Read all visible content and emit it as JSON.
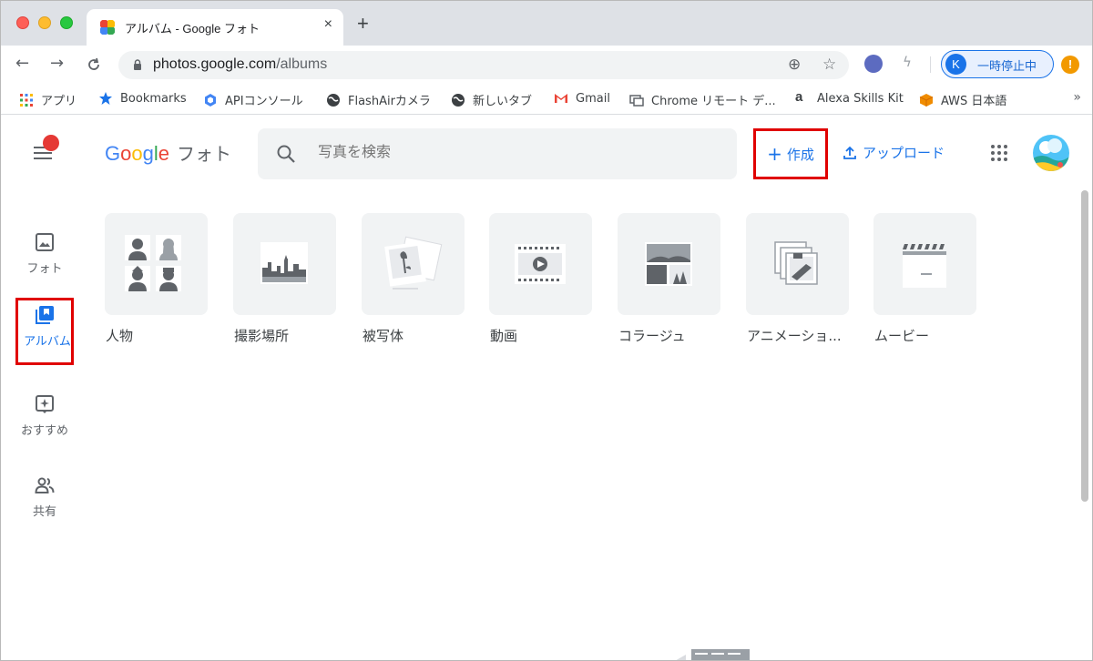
{
  "browser": {
    "tab": {
      "title": "アルバム - Google フォト",
      "close": "×"
    },
    "new_tab": "+",
    "url": {
      "host": "photos.google.com",
      "path": "/albums"
    },
    "profile": {
      "initial": "K",
      "label": "一時停止中"
    },
    "update_badge": "!",
    "bookmarks": [
      {
        "label": "アプリ",
        "icon": "apps-grid-icon"
      },
      {
        "label": "Bookmarks",
        "icon": "star-icon"
      },
      {
        "label": "APIコンソール",
        "icon": "hexagon-icon"
      },
      {
        "label": "FlashAirカメラ",
        "icon": "globe-icon"
      },
      {
        "label": "新しいタブ",
        "icon": "globe-icon"
      },
      {
        "label": "Gmail",
        "icon": "gmail-icon"
      },
      {
        "label": "Chrome リモート デ...",
        "icon": "remote-desktop-icon"
      },
      {
        "label": "Alexa Skills Kit",
        "icon": "amazon-icon"
      },
      {
        "label": "AWS 日本語",
        "icon": "aws-cube-icon"
      }
    ],
    "bookmarks_more": "»"
  },
  "app": {
    "logo_letters": [
      "G",
      "o",
      "o",
      "g",
      "l",
      "e"
    ],
    "product": "フォト",
    "search_placeholder": "写真を検索",
    "create_label": "作成",
    "upload_label": "アップロード"
  },
  "sidebar": [
    {
      "label": "フォト",
      "icon": "photo-icon",
      "active": false
    },
    {
      "label": "アルバム",
      "icon": "album-icon",
      "active": true
    },
    {
      "label": "おすすめ",
      "icon": "sparkle-icon",
      "active": false
    },
    {
      "label": "共有",
      "icon": "people-icon",
      "active": false
    }
  ],
  "albums": [
    {
      "label": "人物",
      "icon": "people-grid-icon"
    },
    {
      "label": "撮影場所",
      "icon": "city-icon"
    },
    {
      "label": "被写体",
      "icon": "object-photos-icon"
    },
    {
      "label": "動画",
      "icon": "video-icon"
    },
    {
      "label": "コラージュ",
      "icon": "collage-icon"
    },
    {
      "label": "アニメーショ...",
      "icon": "animation-icon"
    },
    {
      "label": "ムービー",
      "icon": "clapperboard-icon"
    }
  ],
  "colors": {
    "accent": "#1a73e8",
    "highlight_border": "#e00000",
    "tile_bg": "#f1f3f4"
  }
}
